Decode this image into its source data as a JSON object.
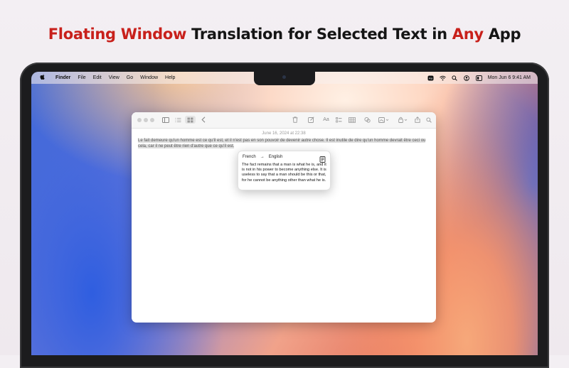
{
  "headline": {
    "part1": "Floating Window",
    "part2": " Translation for Selected Text in ",
    "part3": "Any",
    "part4": " App"
  },
  "menubar": {
    "apple": "",
    "app": "Finder",
    "items": [
      "File",
      "Edit",
      "View",
      "Go",
      "Window",
      "Help"
    ],
    "clock": "Mon Jun 6  9:41 AM"
  },
  "note": {
    "date": "June 16, 2024 at 22:38",
    "text": "Le fait demeure qu'un homme est ce qu'il est, et il n'est pas en son pouvoir de devenir autre chose. Il est inutile de dire qu'un homme devrait être ceci ou cela, car il ne peut être rien d'autre que ce qu'il est."
  },
  "popup": {
    "source_lang": "French",
    "arrow": "→",
    "target_lang": "English",
    "translation": "The fact remains that a man is what he is, and it is not in his power to become anything else. It is useless to say that a man should be this or that, for he cannot be anything other than what he is."
  },
  "colors": {
    "accent": "#c8201b",
    "headline": "#151515"
  }
}
